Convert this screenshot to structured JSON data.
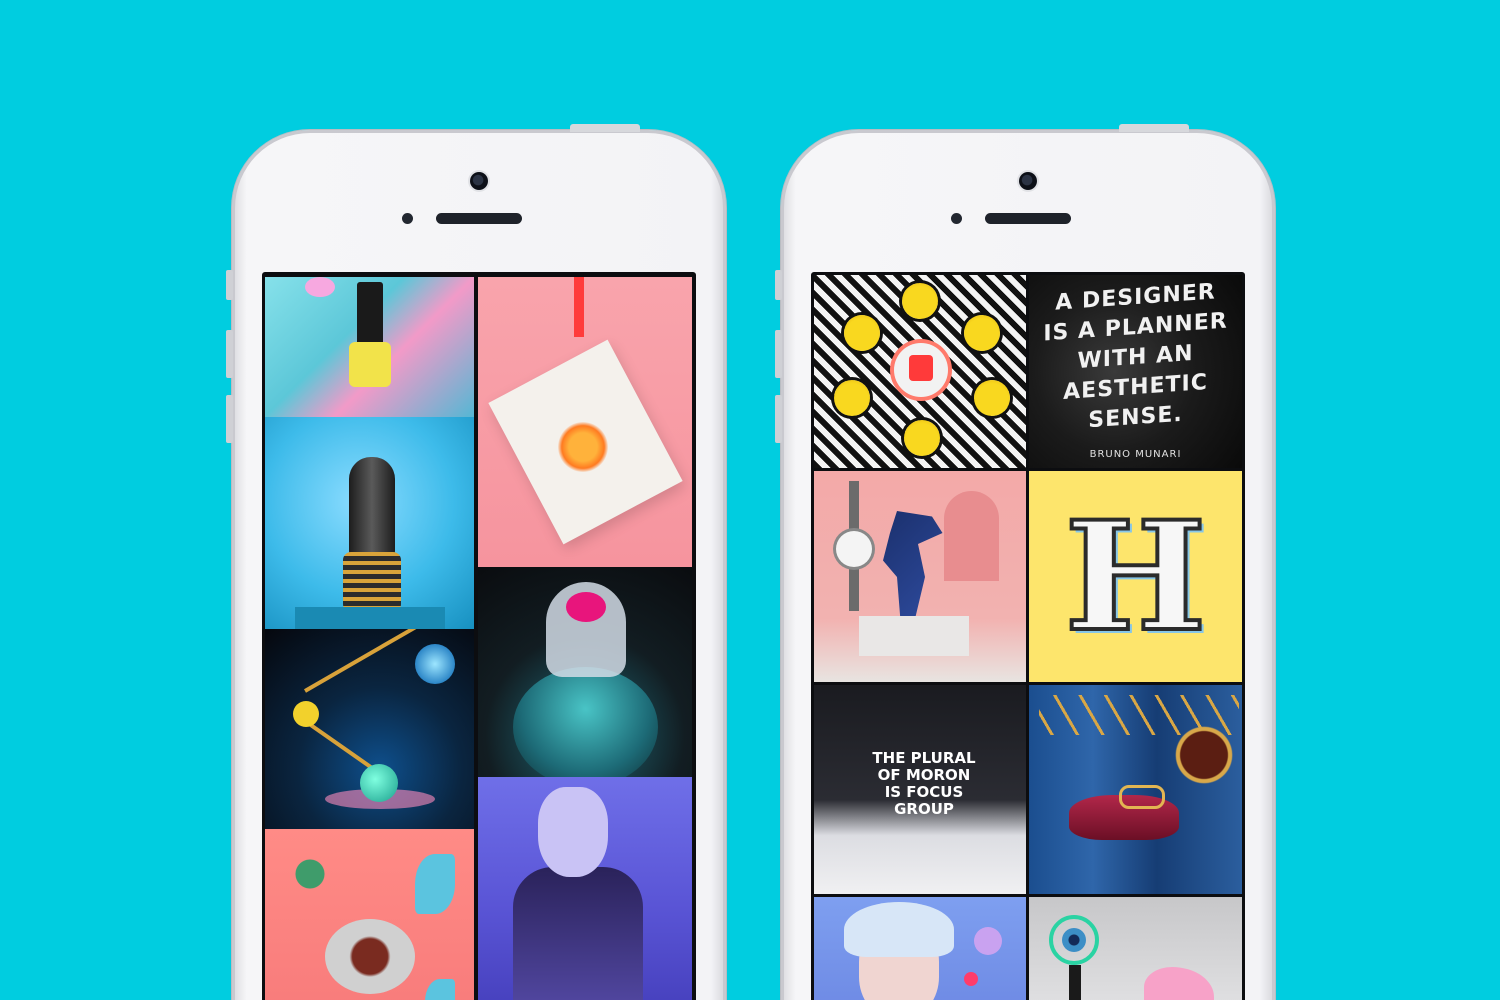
{
  "background_color": "#00cde0",
  "phones": [
    {
      "id": "left",
      "tiles": [
        {
          "subject": "nail polish on glossy surface"
        },
        {
          "subject": "mannequin hand on spring"
        },
        {
          "subject": "desk lamp with glowing spheres"
        },
        {
          "subject": "plated sculpture"
        },
        {
          "subject": "typographic card"
        },
        {
          "subject": "jar on basketball"
        },
        {
          "subject": "person portrait"
        }
      ]
    },
    {
      "id": "right",
      "tiles": [
        {
          "subject": "emoji plates pattern"
        },
        {
          "subject": "quote on fabric"
        },
        {
          "subject": "dinosaur with watch"
        },
        {
          "subject": "letter H"
        },
        {
          "subject": "focus group quote"
        },
        {
          "subject": "cushion with glasses"
        },
        {
          "subject": "portrait blue hair"
        },
        {
          "subject": "eye sculpture"
        }
      ]
    }
  ],
  "quote_card": {
    "lines": [
      "A DESIGNER",
      "IS A PLANNER",
      "WITH AN",
      "AESTHETIC",
      "SENSE."
    ],
    "author": "BRUNO MUNARI"
  },
  "plural_card": {
    "lines": [
      "THE PLURAL",
      "OF MORON",
      "IS FOCUS",
      "GROUP"
    ]
  },
  "letter_card": {
    "letter": "H"
  }
}
